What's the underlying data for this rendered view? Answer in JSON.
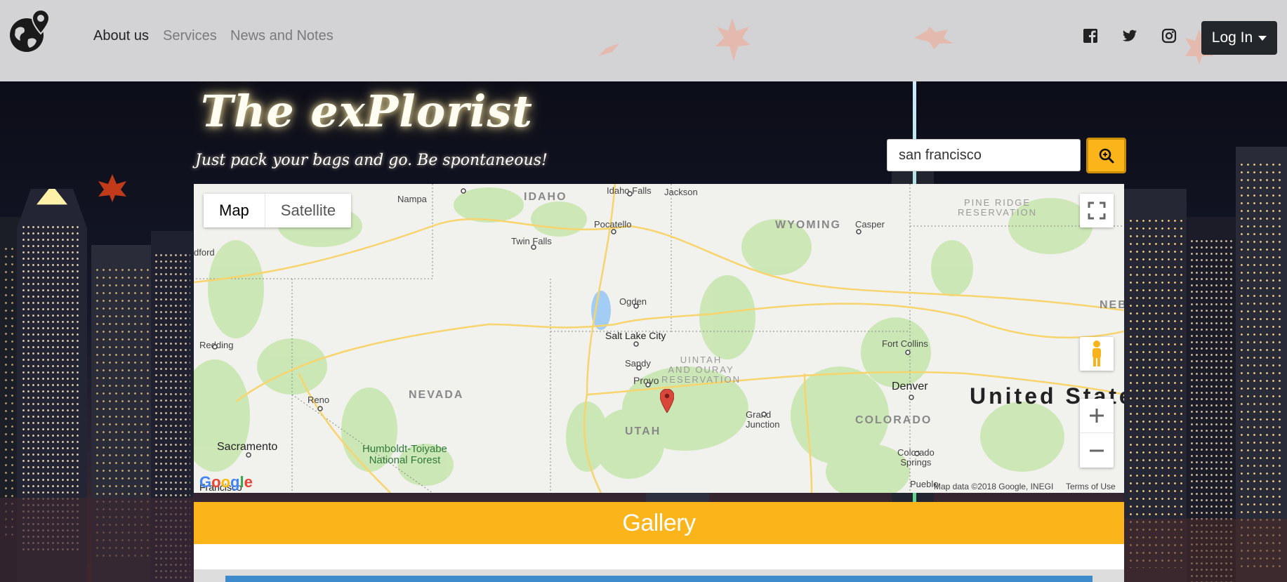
{
  "nav": {
    "links": [
      {
        "label": "About us",
        "active": true
      },
      {
        "label": "Services",
        "active": false
      },
      {
        "label": "News and Notes",
        "active": false
      }
    ],
    "social_icons": [
      "facebook-icon",
      "twitter-icon",
      "instagram-icon"
    ],
    "login_label": "Log In"
  },
  "hero": {
    "title": "The exPlorist",
    "subtitle": "Just pack your bags and go. Be spontaneous!"
  },
  "search": {
    "value": "san francisco",
    "button_icon": "zoom-in-icon"
  },
  "map": {
    "type_options": [
      "Map",
      "Satellite"
    ],
    "selected_type": "Map",
    "labels": {
      "nampa": "Nampa",
      "idaho": "IDAHO",
      "idaho_falls": "Idaho Falls",
      "jackson": "Jackson",
      "pine_ridge": "PINE RIDGE\nRESERVATION",
      "pocatello": "Pocatello",
      "wyoming": "WYOMING",
      "casper": "Casper",
      "twin_falls": "Twin Falls",
      "medford": "dford",
      "ogden": "Ogden",
      "slc": "Salt Lake City",
      "nebraska": "NEB",
      "redding": "Redding",
      "sandy": "Sandy",
      "uintah": "UINTAH\nAND OURAY\nRESERVATION",
      "fort_collins": "Fort Collins",
      "provo": "Provo",
      "nevada": "NEVADA",
      "denver": "Denver",
      "reno": "Reno",
      "united_states": "United State",
      "grand_junction": "Grand\nJunction",
      "utah": "UTAH",
      "colorado": "COLORADO",
      "sacramento": "Sacramento",
      "humboldt": "Humboldt-Toiyabe\nNational Forest",
      "colorado_springs": "Colorado\nSprings",
      "pueblo": "Pueblo",
      "sf": "Francisco"
    },
    "google_logo": "Google",
    "attribution": "Map data ©2018 Google, INEGI",
    "terms": "Terms of Use"
  },
  "gallery": {
    "title": "Gallery"
  },
  "colors": {
    "accent": "#fbb419",
    "navbar_bg": "#d3d3d5",
    "login_bg": "#23272b",
    "marker": "#d9473b"
  }
}
